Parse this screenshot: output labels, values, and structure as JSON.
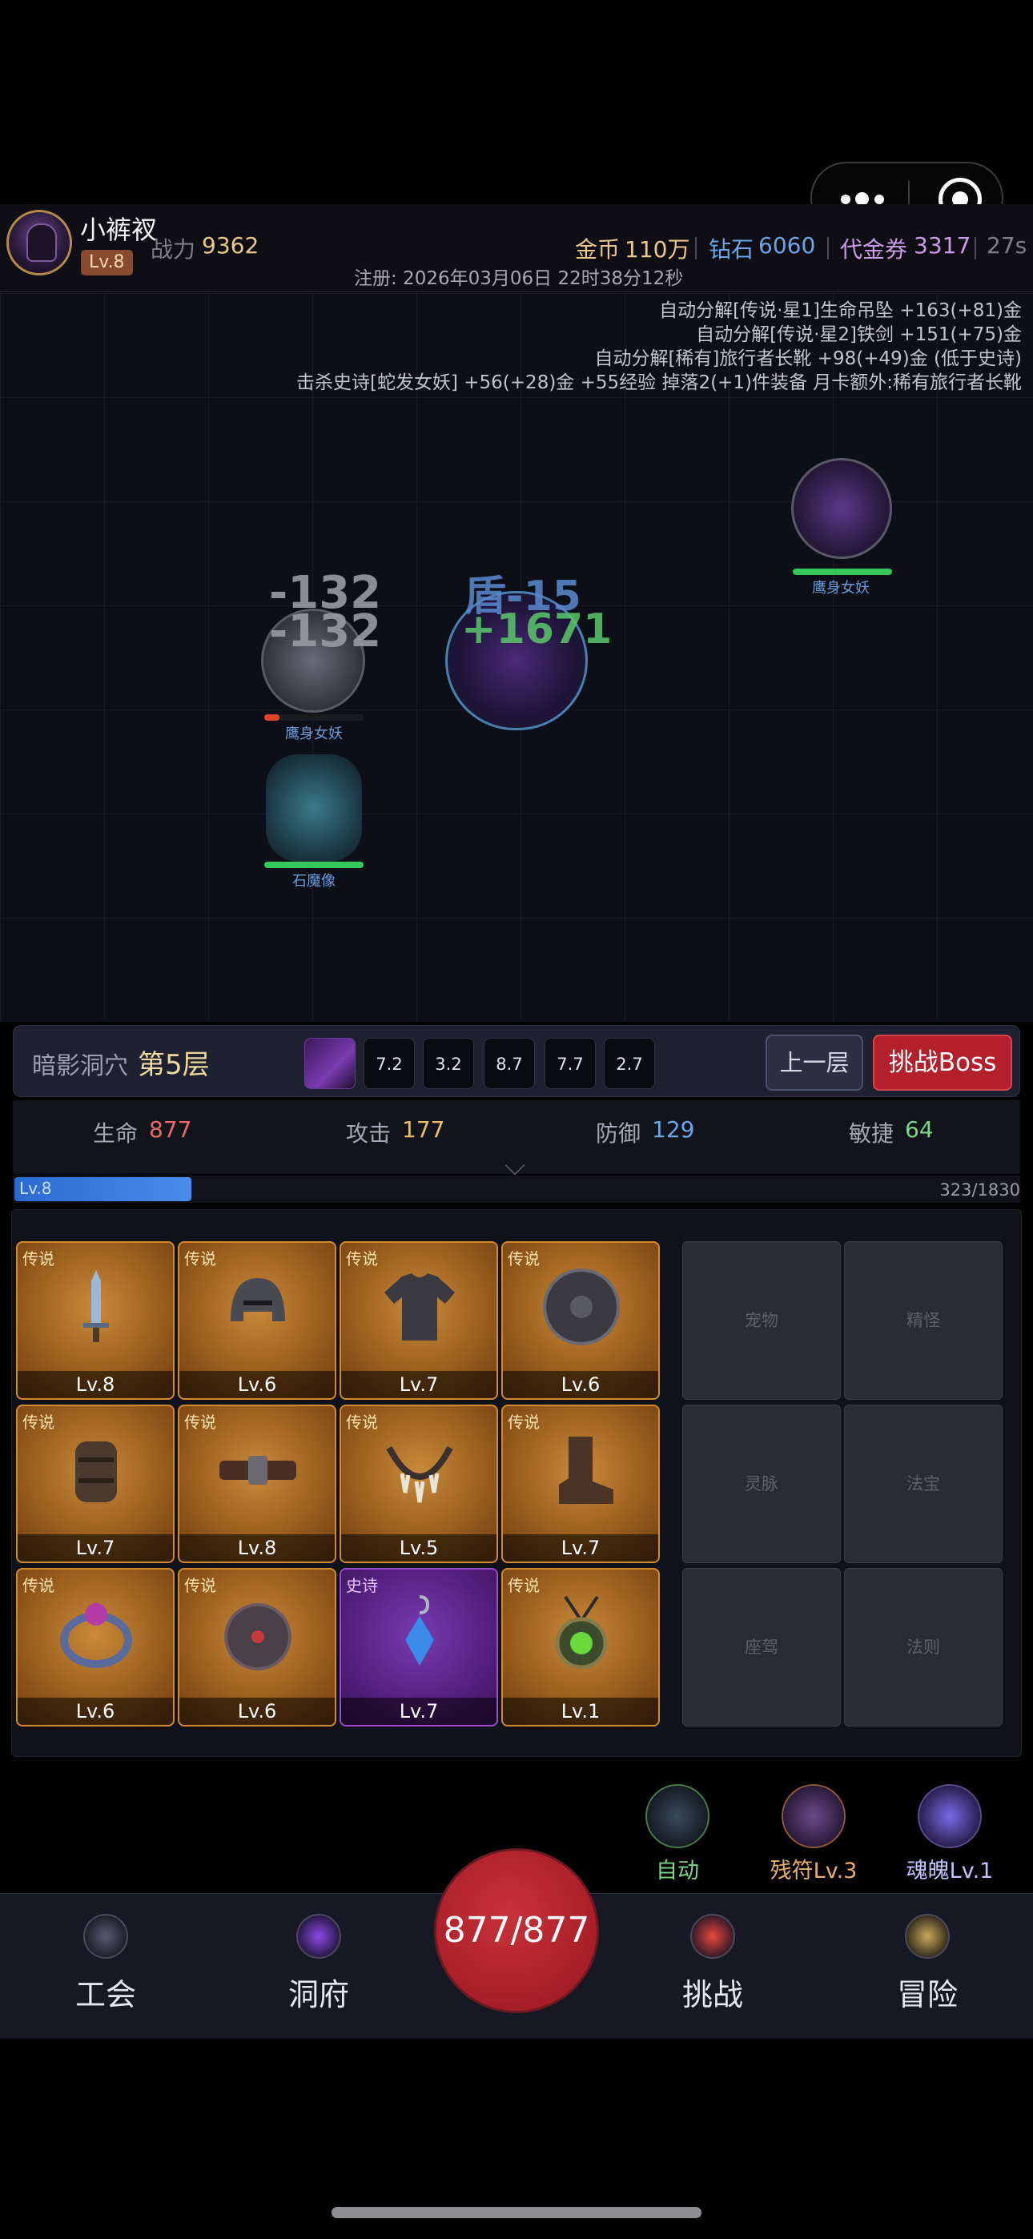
{
  "header": {
    "player_name": "小裤衩",
    "level": "Lv.8",
    "power_label": "战力",
    "power_value": "9362",
    "gold_label": "金币",
    "gold_value": "110万",
    "diamond_label": "钻石",
    "diamond_value": "6060",
    "voucher_label": "代金券",
    "voucher_value": "3317",
    "timer": "27s",
    "register_text": "注册: 2026年03月06日 22时38分12秒",
    "colors": {
      "gold": "#e8c98a",
      "diamond": "#6aa6e8",
      "voucher": "#c89ae8"
    }
  },
  "battle_log": [
    "自动分解[传说·星1]生命吊坠 +163(+81)金",
    "自动分解[传说·星2]铁剑 +151(+75)金",
    "自动分解[稀有]旅行者长靴 +98(+49)金 (低于史诗)",
    "击杀史诗[蛇发女妖] +56(+28)金 +55经验 掉落2(+1)件装备 月卡额外:稀有旅行者长靴"
  ],
  "battlefield": {
    "enemy_right": {
      "name": "鹰身女妖",
      "hp_fraction": 1.0
    },
    "enemy_left": {
      "name": "鹰身女妖",
      "hp_fraction": 0.15,
      "damage_1": "-132",
      "damage_2": "-132"
    },
    "enemy_golem": {
      "name": "石魔像",
      "hp_fraction": 1.0
    },
    "player": {
      "shield_text": "盾-15",
      "heal_text": "+1671"
    }
  },
  "floor": {
    "name": "暗影洞穴",
    "number": "第5层",
    "skills": [
      "7.2",
      "3.2",
      "8.7",
      "7.7",
      "2.7"
    ],
    "prev_button": "上一层",
    "boss_button": "挑战Boss"
  },
  "stats": [
    {
      "label": "生命",
      "value": "877",
      "color": "#e86a6a"
    },
    {
      "label": "攻击",
      "value": "177",
      "color": "#e8c06a"
    },
    {
      "label": "防御",
      "value": "129",
      "color": "#6aa6e8"
    },
    {
      "label": "敏捷",
      "value": "64",
      "color": "#7ad68a"
    }
  ],
  "xp": {
    "level": "Lv.8",
    "text": "323/1830",
    "fraction": 0.1765
  },
  "equipment": [
    {
      "rarity": "传说",
      "level": "Lv.8",
      "icon": "sword-icon"
    },
    {
      "rarity": "传说",
      "level": "Lv.6",
      "icon": "helmet-icon"
    },
    {
      "rarity": "传说",
      "level": "Lv.7",
      "icon": "shirt-icon"
    },
    {
      "rarity": "传说",
      "level": "Lv.6",
      "icon": "shield-icon"
    },
    {
      "rarity": "传说",
      "level": "Lv.7",
      "icon": "bracer-icon"
    },
    {
      "rarity": "传说",
      "level": "Lv.8",
      "icon": "belt-icon"
    },
    {
      "rarity": "传说",
      "level": "Lv.5",
      "icon": "necklace-icon"
    },
    {
      "rarity": "传说",
      "level": "Lv.7",
      "icon": "boot-icon"
    },
    {
      "rarity": "传说",
      "level": "Lv.6",
      "icon": "ring-icon"
    },
    {
      "rarity": "传说",
      "level": "Lv.6",
      "icon": "amulet-disc-icon"
    },
    {
      "rarity": "史诗",
      "level": "Lv.7",
      "icon": "earring-icon"
    },
    {
      "rarity": "传说",
      "level": "Lv.1",
      "icon": "pendant-icon"
    }
  ],
  "empty_slots": [
    "宠物",
    "精怪",
    "灵脉",
    "法宝",
    "座驾",
    "法则"
  ],
  "side_buttons": [
    {
      "label": "自动",
      "color": "#7ad68a",
      "icon": "auto-icon"
    },
    {
      "label": "残符Lv.3",
      "color": "#e8b06a",
      "icon": "rune-icon"
    },
    {
      "label": "魂魄Lv.1",
      "color": "#c0c4ff",
      "icon": "soul-icon"
    }
  ],
  "nav": {
    "guild": "工会",
    "cave": "洞府",
    "hp": "877/877",
    "challenge": "挑战",
    "adventure": "冒险"
  }
}
